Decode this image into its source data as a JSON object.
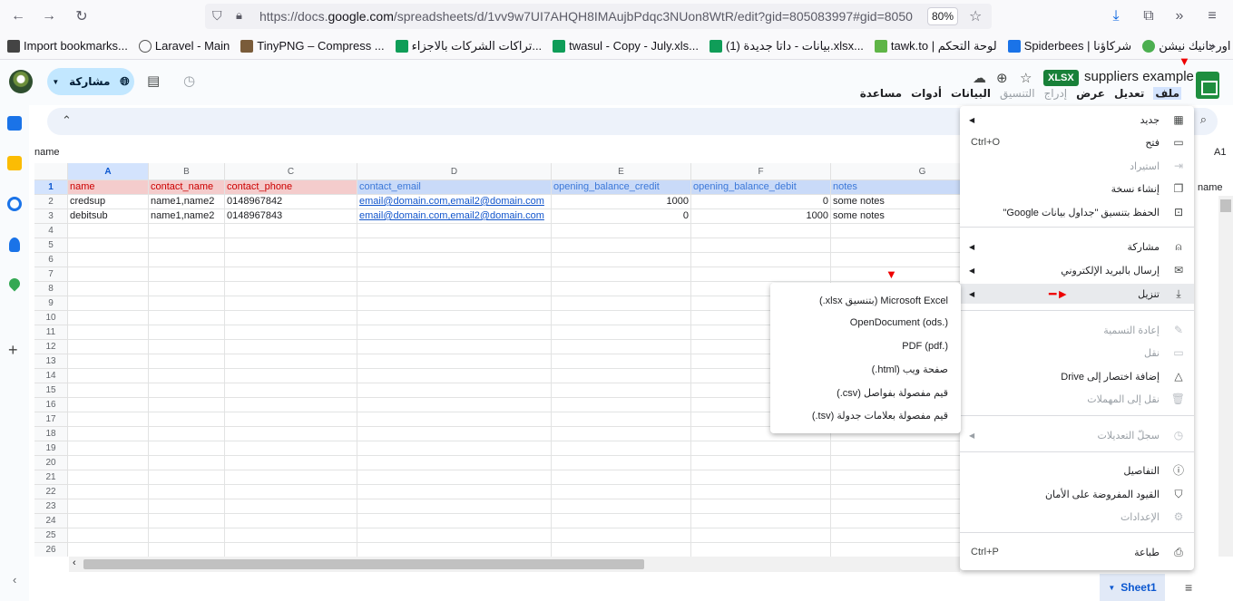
{
  "browser": {
    "url_prefix": "https://docs.",
    "url_domain": "google.com",
    "url_rest": "/spreadsheets/d/1vv9w7UI7AHQH8IMAujbPdqc3NUon8WtR/edit?gid=805083997#gid=8050",
    "zoom": "80%"
  },
  "bookmarks": [
    "Import bookmarks...",
    "Laravel - Main",
    "TinyPNG – Compress ...",
    "تراكات الشركات بالاجزاء...",
    "twasul - Copy - July.xls...",
    "بيانات - داتا جديدة (1).xlsx...",
    "tawk.to | لوحة التحكم",
    "Spiderbees | شركاؤنا",
    "الحمراء - اورجانيك نيشن..."
  ],
  "sheets": {
    "title": "suppliers example",
    "badge": "XLSX",
    "share_label": "مشاركة",
    "menus": [
      "ملف",
      "تعديل",
      "عرض",
      "إدراج",
      "التنسيق",
      "البيانات",
      "أدوات",
      "مساعدة"
    ],
    "name_box": "name",
    "cell_ref": "A1",
    "sheet_tab": "Sheet1",
    "name_partial": "name"
  },
  "grid": {
    "columns": [
      "A",
      "B",
      "C",
      "D",
      "E",
      "F",
      "G"
    ],
    "rows": [
      "1",
      "2",
      "3",
      "4",
      "5",
      "6",
      "7",
      "8",
      "9",
      "10",
      "11",
      "12",
      "13",
      "14",
      "15",
      "16",
      "17",
      "18",
      "19",
      "20",
      "21",
      "22",
      "23",
      "24",
      "25",
      "26"
    ],
    "header_row": [
      "name",
      "contact_name",
      "contact_phone",
      "contact_email",
      "opening_balance_credit",
      "opening_balance_debit",
      "notes"
    ],
    "data": [
      [
        "credsup",
        "name1,name2",
        "0148967842",
        "email@domain.com,email2@domain.com",
        "1000",
        "0",
        "some notes"
      ],
      [
        "debitsub",
        "name1,name2",
        "0148967843",
        "email@domain.com,email2@domain.com",
        "0",
        "1000",
        "some notes"
      ]
    ]
  },
  "file_menu": {
    "items": [
      {
        "label": "جديد",
        "icon": "new-icon",
        "shortcut": "",
        "submenu": true,
        "disabled": false
      },
      {
        "label": "فتح",
        "icon": "folder-icon",
        "shortcut": "Ctrl+O",
        "submenu": false,
        "disabled": false
      },
      {
        "label": "استيراد",
        "icon": "import-icon",
        "shortcut": "",
        "submenu": false,
        "disabled": true
      },
      {
        "label": "إنشاء نسخة",
        "icon": "copy-icon",
        "shortcut": "",
        "submenu": false,
        "disabled": false
      },
      {
        "label": "الحفظ بتنسيق \"جداول بيانات Google\"",
        "icon": "save-icon",
        "shortcut": "",
        "submenu": false,
        "disabled": false
      },
      {
        "label": "مشاركة",
        "icon": "share-person-icon",
        "shortcut": "",
        "submenu": true,
        "disabled": false
      },
      {
        "label": "إرسال بالبريد الإلكتروني",
        "icon": "mail-icon",
        "shortcut": "",
        "submenu": true,
        "disabled": false
      },
      {
        "label": "تنزيل",
        "icon": "download-icon",
        "shortcut": "",
        "submenu": true,
        "disabled": false
      },
      {
        "label": "إعادة التسمية",
        "icon": "pencil-icon",
        "shortcut": "",
        "submenu": false,
        "disabled": true
      },
      {
        "label": "نقل",
        "icon": "move-folder-icon",
        "shortcut": "",
        "submenu": false,
        "disabled": true
      },
      {
        "label": "إضافة اختصار إلى Drive",
        "icon": "drive-shortcut-icon",
        "shortcut": "",
        "submenu": false,
        "disabled": false
      },
      {
        "label": "نقل إلى المهملات",
        "icon": "trash-icon",
        "shortcut": "",
        "submenu": false,
        "disabled": true
      },
      {
        "label": "سجلّ التعديلات",
        "icon": "history-icon",
        "shortcut": "",
        "submenu": true,
        "disabled": true
      },
      {
        "label": "التفاصيل",
        "icon": "info-icon",
        "shortcut": "",
        "submenu": false,
        "disabled": false
      },
      {
        "label": "القيود المفروضة على الأمان",
        "icon": "shield-icon",
        "shortcut": "",
        "submenu": false,
        "disabled": false
      },
      {
        "label": "الإعدادات",
        "icon": "gear-icon",
        "shortcut": "",
        "submenu": false,
        "disabled": true
      },
      {
        "label": "طباعة",
        "icon": "print-icon",
        "shortcut": "Ctrl+P",
        "submenu": false,
        "disabled": false
      }
    ]
  },
  "download_menu": {
    "items": [
      "Microsoft Excel (بتنسيق xlsx.)",
      "OpenDocument (ods.)",
      "PDF (pdf.)",
      "صفحة ويب (html.)",
      "قيم مفصولة بفواصل (csv.)",
      "قيم مفصولة بعلامات جدولة (tsv.)"
    ]
  },
  "colors": {
    "accent": "#0b57d0",
    "header_red": "#f4cccc",
    "header_blue": "#c9daf8",
    "sheets_green": "#1e8e3e"
  }
}
